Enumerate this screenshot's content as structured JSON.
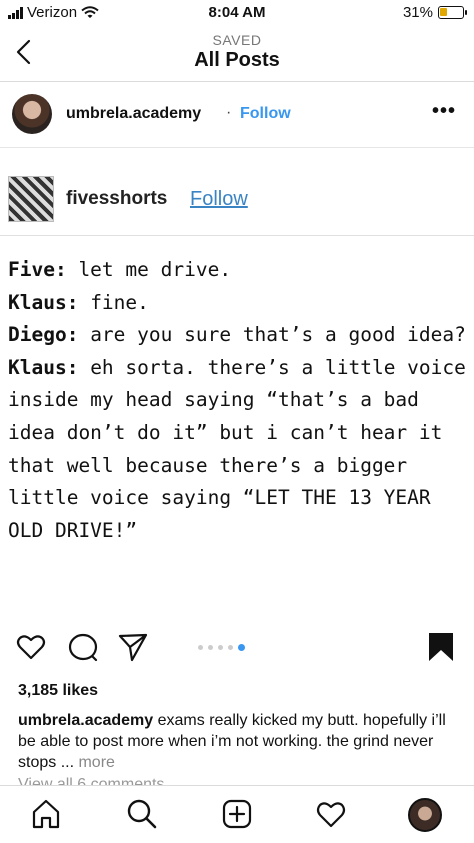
{
  "status_bar": {
    "carrier": "Verizon",
    "time": "8:04 AM",
    "battery": "31%",
    "battery_level": 0.31
  },
  "nav": {
    "subtitle": "SAVED",
    "title": "All Posts"
  },
  "post": {
    "username": "umbrela.academy",
    "separator": "·",
    "follow_label": "Follow",
    "more_label": "•••"
  },
  "image_content": {
    "username": "fivesshorts",
    "follow_label": "Follow",
    "lines": [
      {
        "speaker": "Five:",
        "text": " let me drive."
      },
      {
        "speaker": "Klaus:",
        "text": " fine."
      },
      {
        "speaker": "Diego:",
        "text": " are you sure that’s a good idea?"
      },
      {
        "speaker": "Klaus:",
        "text": " eh sorta. there’s a little voice inside my head saying “that’s a bad idea don’t do it” but i can’t hear it that well because there’s a bigger little voice saying “LET THE 13 YEAR OLD DRIVE!”"
      }
    ]
  },
  "actions": {
    "icons": [
      "heart-icon",
      "comment-icon",
      "share-icon",
      "bookmark-icon"
    ],
    "carousel_index": 5,
    "carousel_total": 5
  },
  "likes": "3,185 likes",
  "caption": {
    "username": "umbrela.academy",
    "text": " exams really kicked my butt. hopefully i’ll be able to post more when i’m not working. the grind never stops ... ",
    "more": "more"
  },
  "view_comments": "View all 6 comments",
  "tabbar": {
    "icons": [
      "home-icon",
      "search-icon",
      "add-post-icon",
      "activity-heart-icon",
      "profile-avatar"
    ]
  },
  "colors": {
    "accent": "#3897f0",
    "text": "#111111",
    "muted": "#888888"
  }
}
